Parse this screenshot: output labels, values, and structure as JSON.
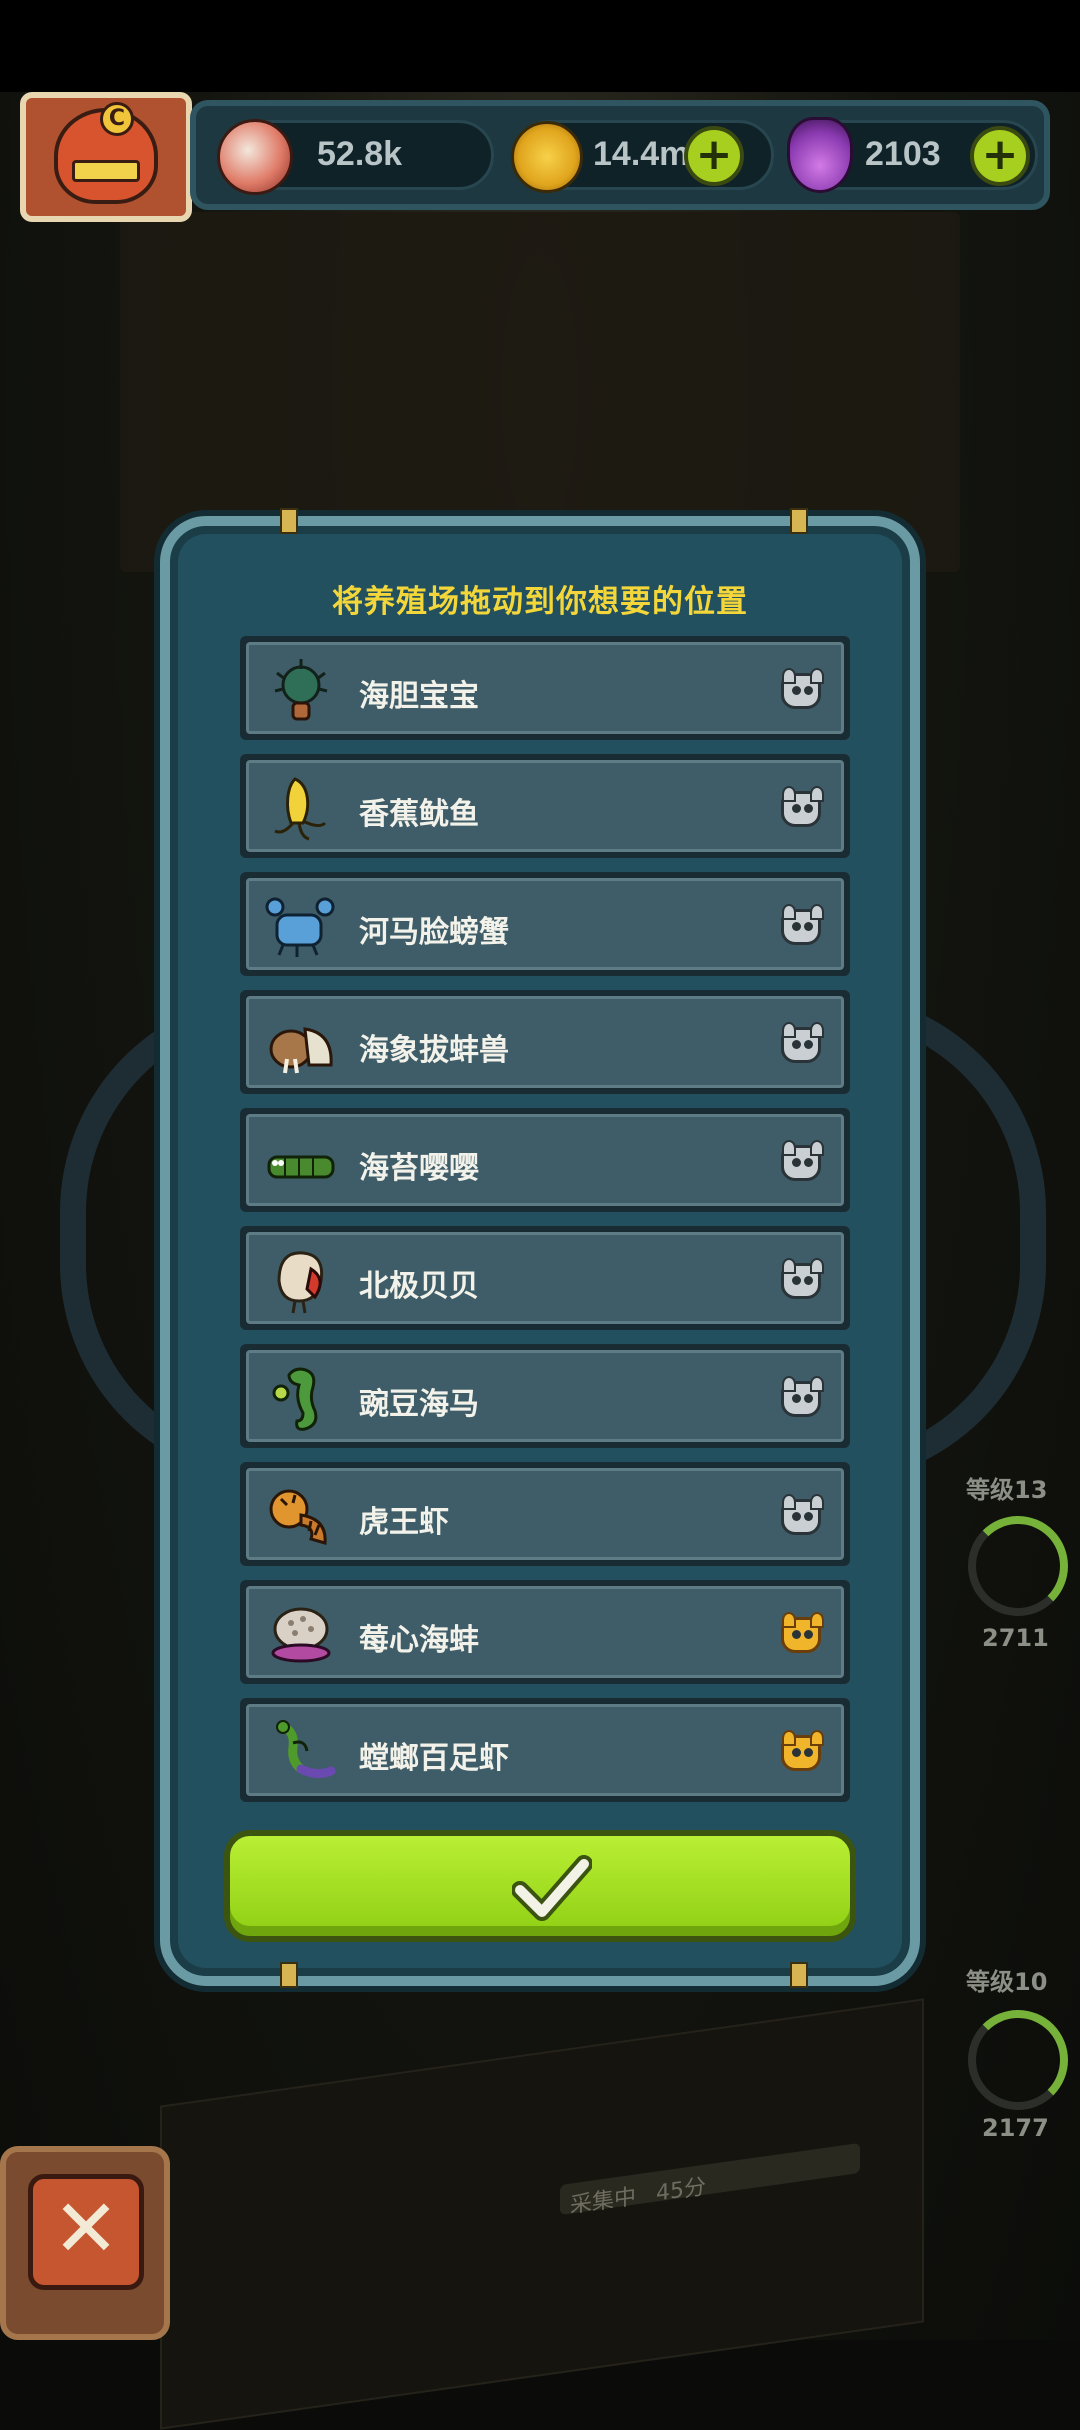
{
  "resources": {
    "eyes": "52.8k",
    "coins": "14.4m",
    "potion": "2103"
  },
  "dialog": {
    "title": "将养殖场拖动到你想要的位置",
    "items": [
      {
        "name": "海胆宝宝",
        "badge": "grey"
      },
      {
        "name": "香蕉鱿鱼",
        "badge": "grey"
      },
      {
        "name": "河马脸螃蟹",
        "badge": "grey"
      },
      {
        "name": "海象拔蚌兽",
        "badge": "grey"
      },
      {
        "name": "海苔嘤嘤",
        "badge": "grey"
      },
      {
        "name": "北极贝贝",
        "badge": "grey"
      },
      {
        "name": "豌豆海马",
        "badge": "grey"
      },
      {
        "name": "虎王虾",
        "badge": "grey"
      },
      {
        "name": "莓心海蚌",
        "badge": "gold"
      },
      {
        "name": "螳螂百足虾",
        "badge": "gold"
      }
    ]
  },
  "side": {
    "level_top": "等级13",
    "count_top": "2711",
    "level_bottom": "等级10",
    "count_bottom": "2177"
  },
  "farm": {
    "status": "采集中",
    "time": "45分"
  },
  "colors": {
    "title": "#f3d63a",
    "confirm": "#a6df1f",
    "panel": "#23505e"
  }
}
